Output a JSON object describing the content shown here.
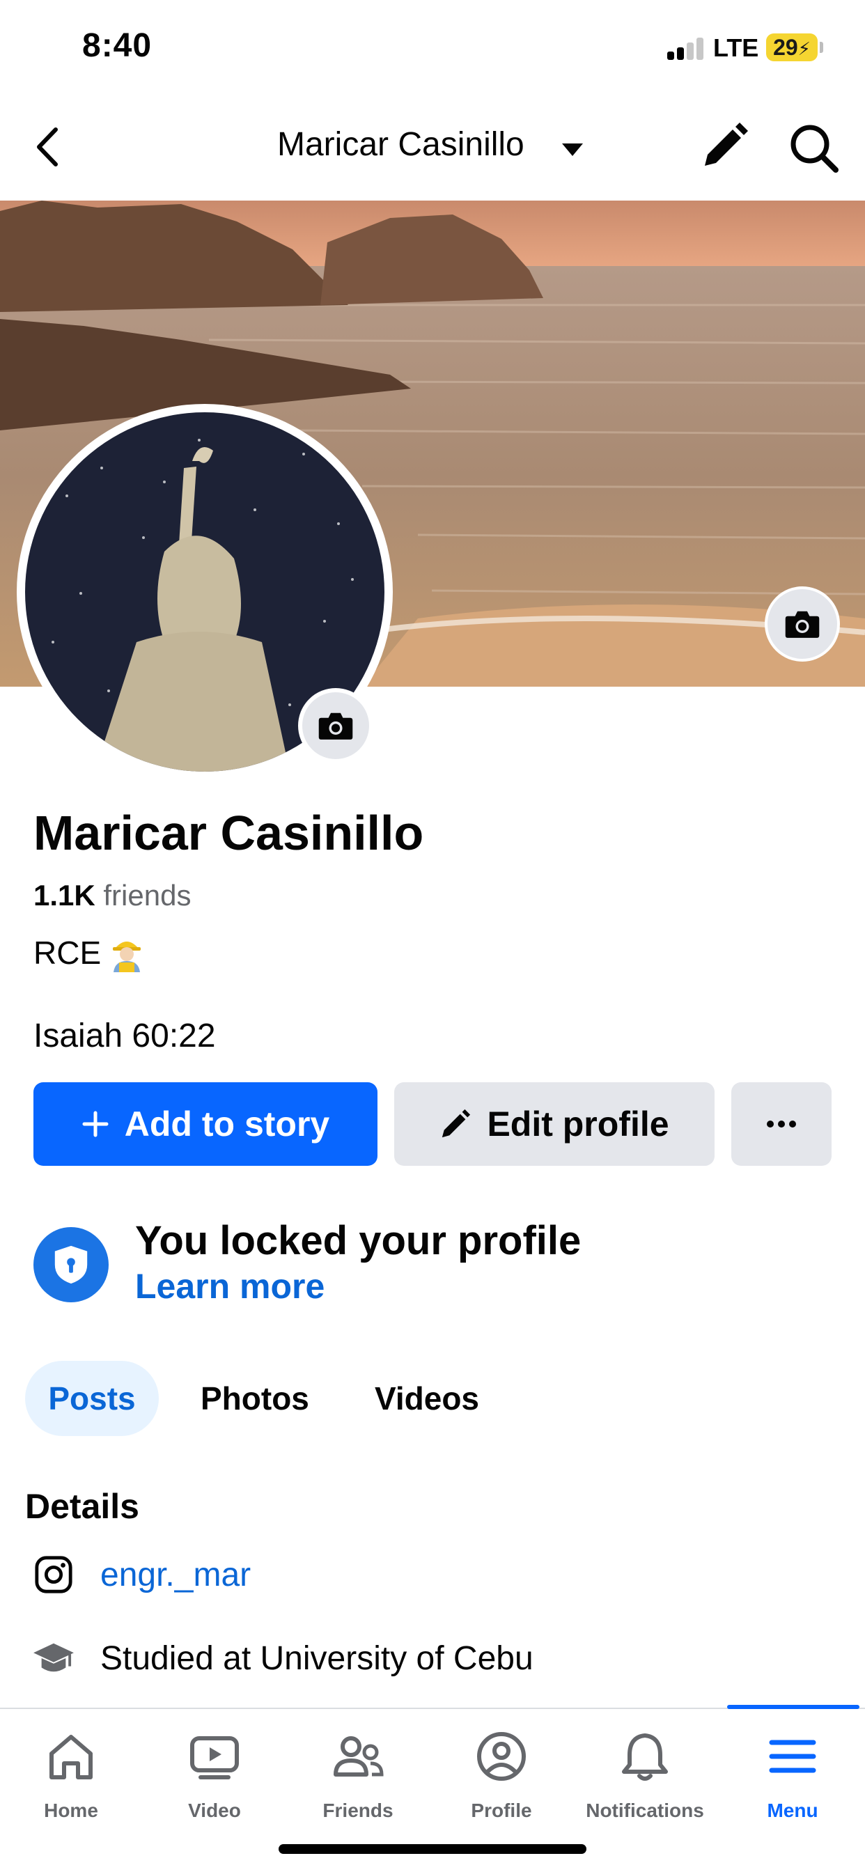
{
  "status_bar": {
    "time": "8:40",
    "network": "LTE",
    "battery": "29"
  },
  "header": {
    "title": "Maricar Casinillo",
    "icons": [
      "back-icon",
      "caret-down-icon",
      "pencil-icon",
      "search-icon"
    ]
  },
  "profile": {
    "name": "Maricar Casinillo",
    "friends_count": "1.1K",
    "friends_label": "friends",
    "bio_line1": "RCE",
    "bio_line2": "Isaiah 60:22"
  },
  "actions": {
    "add_story": "Add to story",
    "edit_profile": "Edit profile"
  },
  "lock_notice": {
    "title": "You locked your profile",
    "link": "Learn more"
  },
  "tabs": [
    {
      "label": "Posts",
      "active": true
    },
    {
      "label": "Photos",
      "active": false
    },
    {
      "label": "Videos",
      "active": false
    }
  ],
  "details": {
    "title": "Details",
    "instagram": "engr._mar",
    "education": "Studied at University of Cebu"
  },
  "bottom_nav": [
    {
      "label": "Home",
      "icon": "home-icon"
    },
    {
      "label": "Video",
      "icon": "video-icon"
    },
    {
      "label": "Friends",
      "icon": "friends-icon"
    },
    {
      "label": "Profile",
      "icon": "profile-icon"
    },
    {
      "label": "Notifications",
      "icon": "bell-icon"
    },
    {
      "label": "Menu",
      "icon": "menu-icon",
      "active": true
    }
  ],
  "colors": {
    "accent": "#0866ff",
    "link": "#0a66d6",
    "secondary_text": "#65676b",
    "button_grey": "#e4e6eb",
    "battery": "#f5d531"
  }
}
